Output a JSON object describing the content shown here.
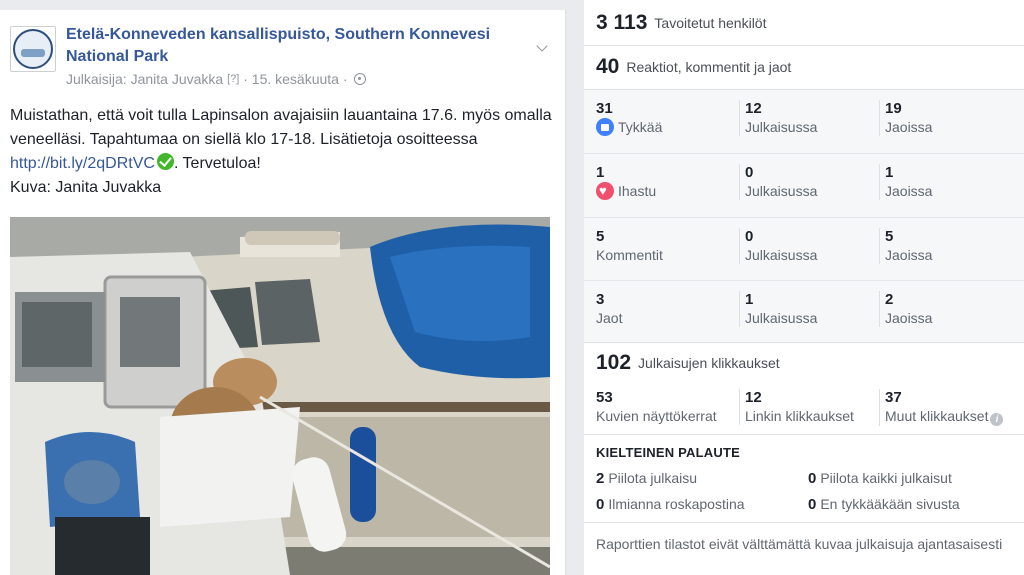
{
  "post": {
    "page_name": "Etelä-Konneveden kansallispuisto, Southern Konnevesi National Park",
    "publisher_prefix": "Julkaisija:",
    "publisher": "Janita Juvakka",
    "help_mark": "[?]",
    "date": "15. kesäkuuta",
    "dot": "·",
    "text_line1": "Muistathan, että voit tulla Lapinsalon avajaisiin lauantaina 17.6. myös omalla veneelläsi. Tapahtumaa on siellä klo 17-18. Lisätietoja osoitteessa",
    "link": "http://bit.ly/2qDRtVC",
    "text_after_link": ". Tervetuloa!",
    "credit": "Kuva: Janita Juvakka",
    "icons": {
      "options": "chevron-down-icon",
      "privacy": "globe-icon",
      "verified": "checkmark-icon"
    }
  },
  "stats": {
    "reach": {
      "value": "3 113",
      "label": "Tavoitetut henkilöt"
    },
    "engagement": {
      "value": "40",
      "label": "Reaktiot, kommentit ja jaot"
    },
    "rows": [
      {
        "total": "31",
        "total_label": "Tykkää",
        "icon": "like-icon",
        "post": "12",
        "post_label": "Julkaisussa",
        "shares": "19",
        "shares_label": "Jaoissa"
      },
      {
        "total": "1",
        "total_label": "Ihastu",
        "icon": "love-icon",
        "post": "0",
        "post_label": "Julkaisussa",
        "shares": "1",
        "shares_label": "Jaoissa"
      },
      {
        "total": "5",
        "total_label": "Kommentit",
        "post": "0",
        "post_label": "Julkaisussa",
        "shares": "5",
        "shares_label": "Jaoissa"
      },
      {
        "total": "3",
        "total_label": "Jaot",
        "post": "1",
        "post_label": "Julkaisussa",
        "shares": "2",
        "shares_label": "Jaoissa"
      }
    ],
    "clicks": {
      "value": "102",
      "label": "Julkaisujen klikkaukset",
      "photo": "53",
      "photo_label": "Kuvien näyttökerrat",
      "link": "12",
      "link_label": "Linkin klikkaukset",
      "other": "37",
      "other_label": "Muut klikkaukset"
    },
    "negative": {
      "title": "KIELTEINEN PALAUTE",
      "hide_post": "2",
      "hide_post_label": "Piilota julkaisu",
      "hide_all": "0",
      "hide_all_label": "Piilota kaikki julkaisut",
      "spam": "0",
      "spam_label": "Ilmianna roskapostina",
      "unlike": "0",
      "unlike_label": "En tykkääkään sivusta"
    },
    "note": "Raporttien tilastot eivät välttämättä kuvaa julkaisuja ajantasaisesti"
  },
  "colors": {
    "link": "#365899",
    "like": "#4080ff",
    "love": "#f0506e",
    "verified": "#42b72a"
  }
}
